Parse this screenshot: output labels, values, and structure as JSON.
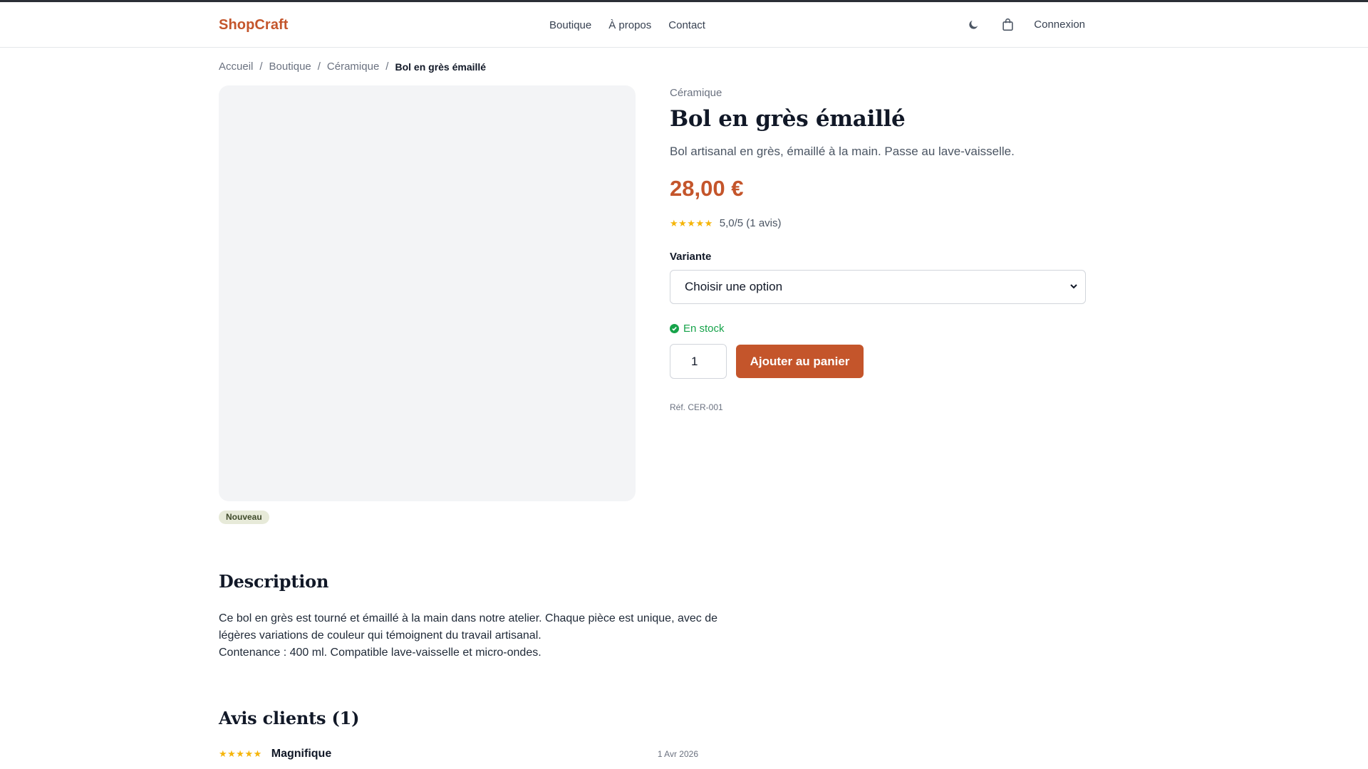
{
  "header": {
    "brand": "ShopCraft",
    "nav": [
      "Boutique",
      "À propos",
      "Contact"
    ],
    "login": "Connexion",
    "icons": [
      "moon-icon",
      "shopping-bag-icon"
    ]
  },
  "breadcrumb": {
    "items": [
      "Accueil",
      "Boutique",
      "Céramique"
    ],
    "current": "Bol en grès émaillé",
    "separator": "/"
  },
  "product": {
    "badge": "Nouveau",
    "category": "Céramique",
    "title": "Bol en grès émaillé",
    "short_description": "Bol artisanal en grès, émaillé à la main. Passe au lave-vaisselle.",
    "price": "28,00 €",
    "rating_stars": "★★★★★",
    "rating_text": "5,0/5 (1 avis)",
    "variant_label": "Variante",
    "variant_value": "Choisir une option",
    "stock": "En stock",
    "quantity": "1",
    "add_to_cart": "Ajouter au panier",
    "sku": "Réf. CER-001"
  },
  "description": {
    "title": "Description",
    "line1": "Ce bol en grès est tourné et émaillé à la main dans notre atelier. Chaque pièce est unique, avec de",
    "line2": "légères variations de couleur qui témoignent du travail artisanal.",
    "line3": "Contenance : 400 ml. Compatible lave-vaisselle et micro-ondes."
  },
  "reviews": {
    "title": "Avis clients (1)",
    "items": [
      {
        "stars": "★★★★★",
        "title": "Magnifique",
        "date": "1 Avr 2026"
      }
    ]
  },
  "colors": {
    "accent": "#c4552b",
    "stock": "#16a34a",
    "stars": "#f5b50a",
    "image_placeholder": "#f3f4f6"
  }
}
